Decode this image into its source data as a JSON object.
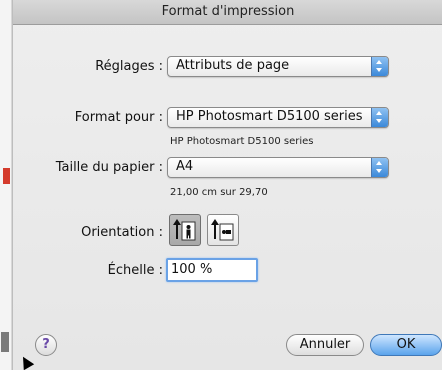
{
  "dialog": {
    "title": "Format d'impression",
    "settings": {
      "label": "Réglages :",
      "value": "Attributs de page"
    },
    "format_for": {
      "label": "Format pour :",
      "value": "HP Photosmart D5100 series",
      "sub": "HP Photosmart D5100 series"
    },
    "paper_size": {
      "label": "Taille du papier :",
      "value": "A4",
      "sub": "21,00 cm sur 29,70"
    },
    "orientation": {
      "label": "Orientation :",
      "selected": "portrait",
      "options": [
        "portrait",
        "landscape"
      ]
    },
    "scale": {
      "label": "Échelle :",
      "value": "100 %"
    },
    "buttons": {
      "cancel": "Annuler",
      "ok": "OK",
      "help": "?"
    }
  },
  "colors": {
    "accent": "#3b88d9",
    "focus_ring": "#6aa2e6"
  },
  "icons": [
    "help-icon",
    "popup-arrows-icon",
    "portrait-orientation-icon",
    "landscape-orientation-icon",
    "mouse-cursor-icon"
  ]
}
